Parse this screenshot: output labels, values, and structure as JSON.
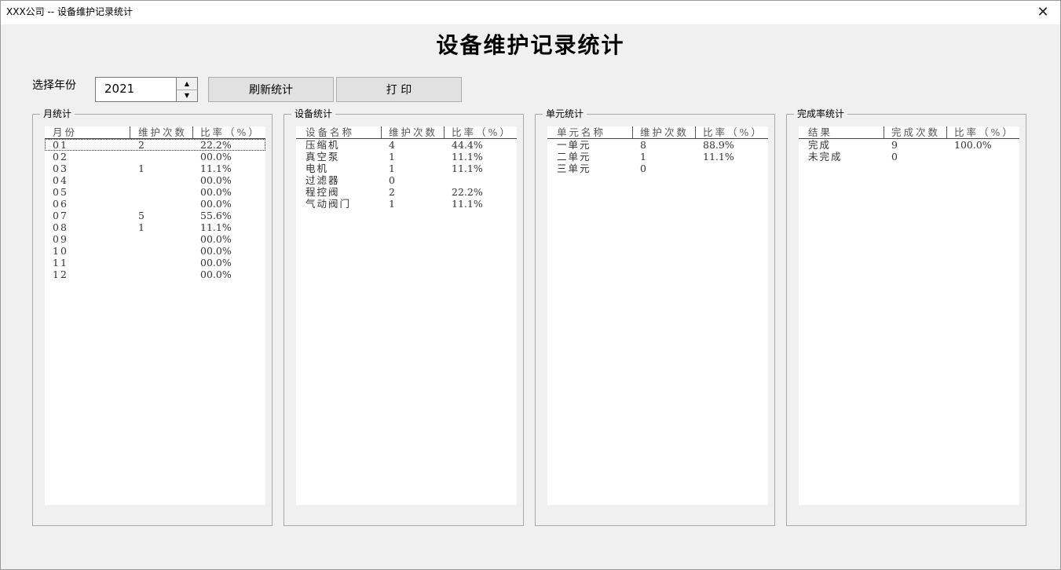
{
  "window": {
    "title": "XXX公司 -- 设备维护记录统计",
    "close_symbol": "✕"
  },
  "page_title": "设备维护记录统计",
  "toolbar": {
    "year_label": "选择年份",
    "year_value": "2021",
    "spin_up": "▲",
    "spin_down": "▼",
    "refresh_label": "刷新统计",
    "print_label": "打 印"
  },
  "month_group": {
    "title": "月统计",
    "columns": [
      "月份",
      "维护次数",
      "比率（%）"
    ],
    "rows": [
      [
        "01",
        "2",
        "22.2%"
      ],
      [
        "02",
        "",
        "00.0%"
      ],
      [
        "03",
        "1",
        "11.1%"
      ],
      [
        "04",
        "",
        "00.0%"
      ],
      [
        "05",
        "",
        "00.0%"
      ],
      [
        "06",
        "",
        "00.0%"
      ],
      [
        "07",
        "5",
        "55.6%"
      ],
      [
        "08",
        "1",
        "11.1%"
      ],
      [
        "09",
        "",
        "00.0%"
      ],
      [
        "10",
        "",
        "00.0%"
      ],
      [
        "11",
        "",
        "00.0%"
      ],
      [
        "12",
        "",
        "00.0%"
      ]
    ]
  },
  "equipment_group": {
    "title": "设备统计",
    "columns": [
      "设备名称",
      "维护次数",
      "比率（%）"
    ],
    "rows": [
      [
        "压缩机",
        "4",
        "44.4%"
      ],
      [
        "真空泵",
        "1",
        "11.1%"
      ],
      [
        "电机",
        "1",
        "11.1%"
      ],
      [
        "过滤器",
        "0",
        ""
      ],
      [
        "程控阀",
        "2",
        "22.2%"
      ],
      [
        "气动阀门",
        "1",
        "11.1%"
      ]
    ]
  },
  "unit_group": {
    "title": "单元统计",
    "columns": [
      "单元名称",
      "维护次数",
      "比率（%）"
    ],
    "rows": [
      [
        "一单元",
        "8",
        "88.9%"
      ],
      [
        "二单元",
        "1",
        "11.1%"
      ],
      [
        "三单元",
        "0",
        ""
      ]
    ]
  },
  "completion_group": {
    "title": "完成率统计",
    "columns": [
      "结果",
      "完成次数",
      "比率（%）"
    ],
    "rows": [
      [
        "完成",
        "9",
        "100.0%"
      ],
      [
        "未完成",
        "0",
        ""
      ]
    ]
  }
}
